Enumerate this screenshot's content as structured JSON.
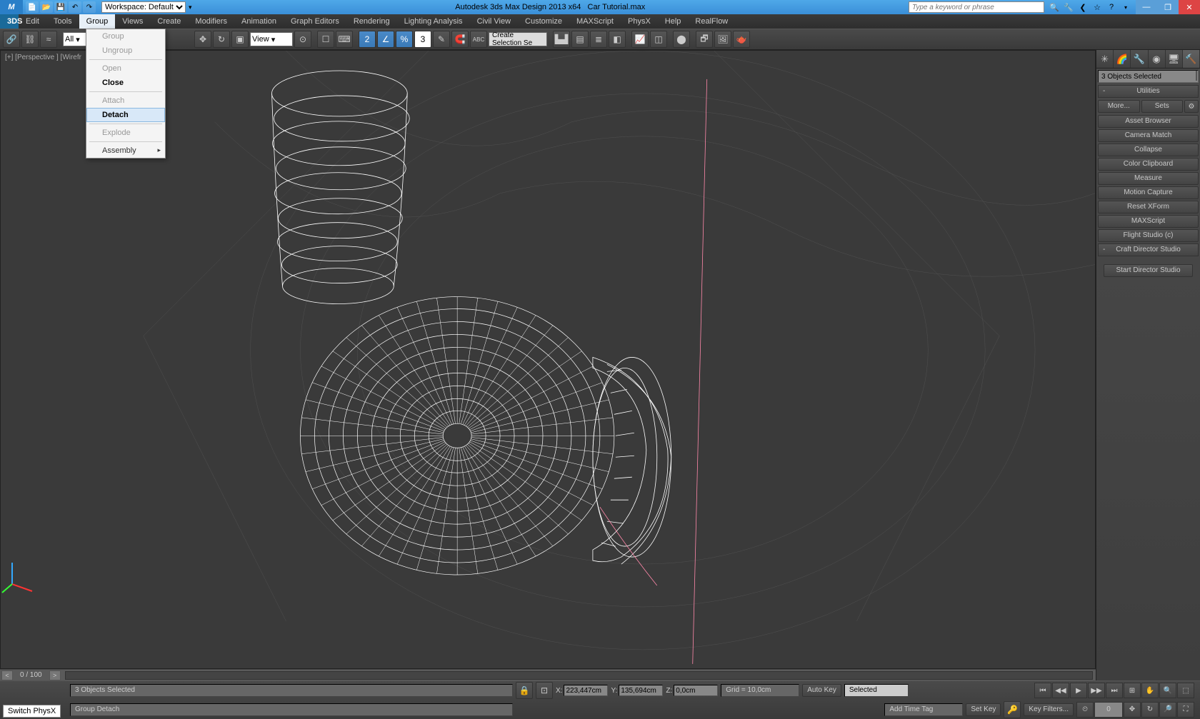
{
  "titlebar": {
    "workspace_label": "Workspace: Default",
    "app_title": "Autodesk 3ds Max Design 2013 x64",
    "file_title": "Car Tutorial.max",
    "search_placeholder": "Type a keyword or phrase"
  },
  "menubar": {
    "items": [
      "Edit",
      "Tools",
      "Group",
      "Views",
      "Create",
      "Modifiers",
      "Animation",
      "Graph Editors",
      "Rendering",
      "Lighting Analysis",
      "Civil View",
      "Customize",
      "MAXScript",
      "PhysX",
      "Help",
      "RealFlow"
    ],
    "active": "Group"
  },
  "dropdown": {
    "items": [
      {
        "label": "Group",
        "disabled": true
      },
      {
        "label": "Ungroup",
        "disabled": true
      },
      {
        "sep": true
      },
      {
        "label": "Open",
        "disabled": true
      },
      {
        "label": "Close",
        "bold": true
      },
      {
        "sep": true
      },
      {
        "label": "Attach",
        "disabled": true
      },
      {
        "label": "Detach",
        "bold": true,
        "highlighted": true
      },
      {
        "sep": true
      },
      {
        "label": "Explode",
        "disabled": true
      },
      {
        "sep": true
      },
      {
        "label": "Assembly",
        "has_sub": true
      }
    ]
  },
  "toolbar": {
    "filter": "All",
    "coord_sys": "View",
    "sel_count": "3",
    "sel_set_placeholder": "Create Selection Se"
  },
  "viewport": {
    "label": "[+] [Perspective ] [Wirefr"
  },
  "timeline": {
    "frame": "0 / 100"
  },
  "cmdpanel": {
    "sel_text": "3 Objects Selected",
    "rollouts": {
      "utilities": "Utilities",
      "craft": "Craft Director Studio"
    },
    "buttons": {
      "more": "More...",
      "sets": "Sets",
      "asset_browser": "Asset Browser",
      "camera_match": "Camera Match",
      "collapse": "Collapse",
      "color_clipboard": "Color Clipboard",
      "measure": "Measure",
      "motion_capture": "Motion Capture",
      "reset_xform": "Reset XForm",
      "maxscript": "MAXScript",
      "flight_studio": "Flight Studio (c)",
      "start_director": "Start Director Studio"
    }
  },
  "statusbar": {
    "selection": "3 Objects Selected",
    "prompt": "Group Detach",
    "x": "223,447cm",
    "y": "135,694cm",
    "z": "0,0cm",
    "grid": "Grid = 10,0cm",
    "autokey": "Auto Key",
    "setkey": "Set Key",
    "selected": "Selected",
    "keyfilters": "Key Filters...",
    "addtimetag": "Add Time Tag",
    "switch": "Switch PhysX"
  }
}
